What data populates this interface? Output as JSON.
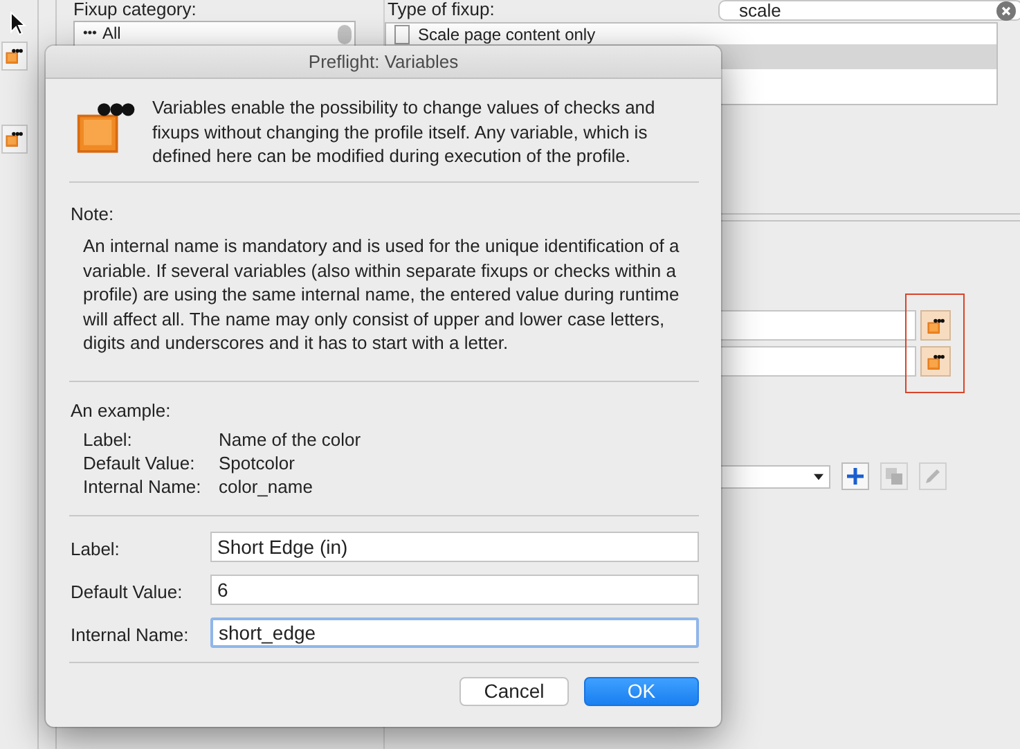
{
  "background": {
    "fixup_category": {
      "label": "Fixup category:",
      "list_items": [
        {
          "label": "All"
        }
      ]
    },
    "type_of_fixup": {
      "label": "Type of fixup:",
      "search": {
        "value": "scale"
      },
      "list_items": [
        {
          "label": "Scale page content only"
        }
      ]
    },
    "tool_buttons": [
      {
        "kind": "add",
        "disabled": false
      },
      {
        "kind": "duplicate",
        "disabled": true
      },
      {
        "kind": "edit",
        "disabled": true
      }
    ]
  },
  "dialog": {
    "title": "Preflight: Variables",
    "intro": "Variables enable the possibility to change values of checks and fixups without changing the profile itself. Any variable, which is defined here can be modified during execution of the profile.",
    "note": {
      "heading": "Note:",
      "text": "An internal name is mandatory and is used for the unique identification of a variable. If several variables (also within separate fixups or checks within a profile) are using the same internal name, the entered value during runtime will affect all. The name may only consist of upper and lower case letters, digits and underscores and it has to start with a letter."
    },
    "example": {
      "heading": "An example:",
      "rows": [
        {
          "label": "Label:",
          "value": "Name of the color"
        },
        {
          "label": "Default Value:",
          "value": "Spotcolor"
        },
        {
          "label": "Internal Name:",
          "value": "color_name"
        }
      ]
    },
    "fields": [
      {
        "label": "Label:",
        "value": "Short Edge (in)",
        "focused": false
      },
      {
        "label": "Default Value:",
        "value": "6",
        "focused": false
      },
      {
        "label": "Internal Name:",
        "value": "short_edge",
        "focused": true
      }
    ],
    "buttons": [
      {
        "label": "Cancel",
        "default": false
      },
      {
        "label": "OK",
        "default": true
      }
    ]
  }
}
